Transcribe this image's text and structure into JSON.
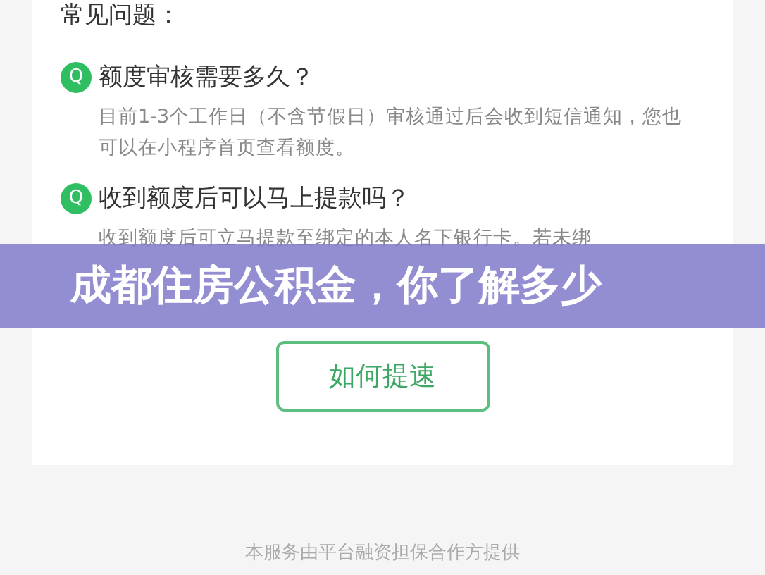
{
  "section_title": "常见问题：",
  "faqs": [
    {
      "badge": "Q",
      "question": "额度审核需要多久？",
      "answer": "目前1-3个工作日（不含节假日）审核通过后会收到短信通知，您也可以在小程序首页查看额度。"
    },
    {
      "badge": "Q",
      "question": "收到额度后可以马上提款吗？",
      "answer": "收到额度后可立马提款至绑定的本人名下银行卡。若未绑"
    }
  ],
  "banner": {
    "title": "成都住房公积金，你了解多少"
  },
  "button": "如何提速",
  "footer": "本服务由平台融资担保合作方提供"
}
